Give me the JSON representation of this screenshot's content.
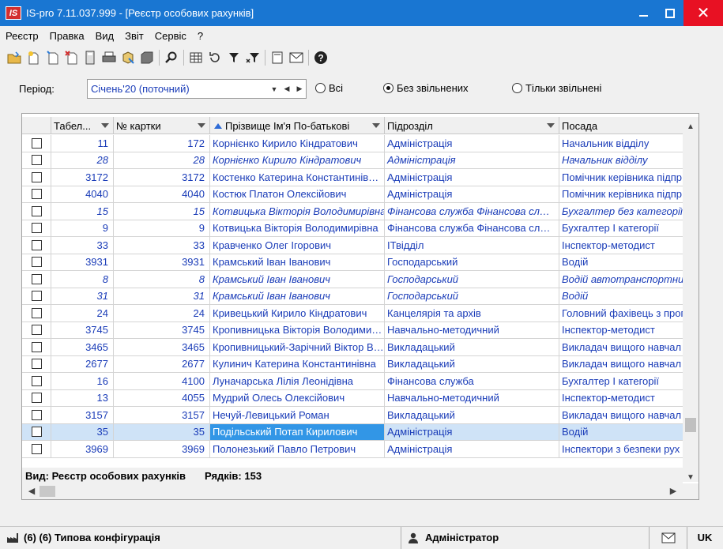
{
  "window": {
    "title": "IS-pro 7.11.037.999 - [Реєстр особових рахунків]",
    "logo": "IS"
  },
  "menu": [
    "Реєстр",
    "Правка",
    "Вид",
    "Звіт",
    "Сервіс",
    "?"
  ],
  "toolbar_icons": [
    "open-folder-icon",
    "new-doc-icon",
    "copy-doc-icon",
    "delete-doc-icon",
    "calculator-icon",
    "print-icon",
    "export-icon",
    "block-icon",
    "search-icon",
    "table-icon",
    "refresh-icon",
    "filter-icon",
    "filter-clear-icon",
    "card-icon",
    "mail-icon",
    "help-icon"
  ],
  "period": {
    "label": "Період:",
    "value": "Січень'20 (поточний)",
    "options": [
      {
        "label": "Всі",
        "checked": false
      },
      {
        "label": "Без звільнених",
        "checked": true
      },
      {
        "label": "Тільки звільнені",
        "checked": false
      }
    ]
  },
  "grid": {
    "columns": [
      "Табел...",
      "№ картки",
      "Прізвище Ім'я По-батькові",
      "Підрозділ",
      "Посада"
    ],
    "rows": [
      {
        "tab": "11",
        "card": "172",
        "name": "Корнієнко Кирило Кіндратович",
        "dept": "Адміністрація",
        "pos": "Начальник відділу",
        "italic": false
      },
      {
        "tab": "28",
        "card": "28",
        "name": "Корнієнко Кирило Кіндратович",
        "dept": "Адміністрація",
        "pos": "Начальник відділу",
        "italic": true
      },
      {
        "tab": "3172",
        "card": "3172",
        "name": "Костенко Катерина Константинів…",
        "dept": "Адміністрація",
        "pos": "Помічник керівника підпр",
        "italic": false
      },
      {
        "tab": "4040",
        "card": "4040",
        "name": "Костюк Платон Олексійович",
        "dept": "Адміністрація",
        "pos": "Помічник керівника підпр",
        "italic": false
      },
      {
        "tab": "15",
        "card": "15",
        "name": "Котвицька Вікторія Володимирівна",
        "dept": "Фінансова служба    Фінансова сл…",
        "pos": "Бухгалтер без категорії",
        "italic": true
      },
      {
        "tab": "9",
        "card": "9",
        "name": "Котвицька Вікторія Володимирівна",
        "dept": "Фінансова служба    Фінансова сл…",
        "pos": "Бухгалтер I категорії",
        "italic": false
      },
      {
        "tab": "33",
        "card": "33",
        "name": "Кравченко Олег Ігорович",
        "dept": "ІТвідділ",
        "pos": "Інспектор-методист",
        "italic": false
      },
      {
        "tab": "3931",
        "card": "3931",
        "name": "Крамський Іван Іванович",
        "dept": "Господарський",
        "pos": "Водій",
        "italic": false
      },
      {
        "tab": "8",
        "card": "8",
        "name": "Крамський Іван Іванович",
        "dept": "Господарський",
        "pos": "Водій автотранспортних",
        "italic": true
      },
      {
        "tab": "31",
        "card": "31",
        "name": "Крамський Іван Іванович",
        "dept": "Господарський",
        "pos": "Водій",
        "italic": true
      },
      {
        "tab": "24",
        "card": "24",
        "name": "Кривецький Кирило Кіндратович",
        "dept": "Канцелярія та архів",
        "pos": "Головний фахівець з прог",
        "italic": false
      },
      {
        "tab": "3745",
        "card": "3745",
        "name": "Кропивницька Вікторія Володими…",
        "dept": "Навчально-методичний",
        "pos": "Інспектор-методист",
        "italic": false
      },
      {
        "tab": "3465",
        "card": "3465",
        "name": "Кропивницький-Зарічний Віктор В…",
        "dept": "Викладацький",
        "pos": "Викладач вищого навчал",
        "italic": false
      },
      {
        "tab": "2677",
        "card": "2677",
        "name": "Кулинич Катерина Константинівна",
        "dept": "Викладацький",
        "pos": "Викладач вищого навчал",
        "italic": false
      },
      {
        "tab": "16",
        "card": "4100",
        "name": "Луначарська Лілія Леонідівна",
        "dept": "Фінансова служба",
        "pos": "Бухгалтер I категорії",
        "italic": false
      },
      {
        "tab": "13",
        "card": "4055",
        "name": "Мудрий Олесь Олексійович",
        "dept": "Навчально-методичний",
        "pos": "Інспектор-методист",
        "italic": false
      },
      {
        "tab": "3157",
        "card": "3157",
        "name": "Нечуй-Левицький Роман",
        "dept": "Викладацький",
        "pos": "Викладач вищого навчал",
        "italic": false
      },
      {
        "tab": "35",
        "card": "35",
        "name": "Подільський Потап Кирилович",
        "dept": "Адміністрація",
        "pos": "Водій",
        "italic": false,
        "selected": true
      },
      {
        "tab": "3969",
        "card": "3969",
        "name": "Полонезький Павло Петрович",
        "dept": "Адміністрація",
        "pos": "Інспектори з безпеки рух",
        "italic": false
      }
    ]
  },
  "footer": {
    "view": "Вид: Реєстр особових рахунків",
    "rows": "Рядків: 153"
  },
  "statusbar": {
    "config": "(6) (6) Типова конфігурація",
    "user": "Адміністратор",
    "lang": "UK"
  }
}
